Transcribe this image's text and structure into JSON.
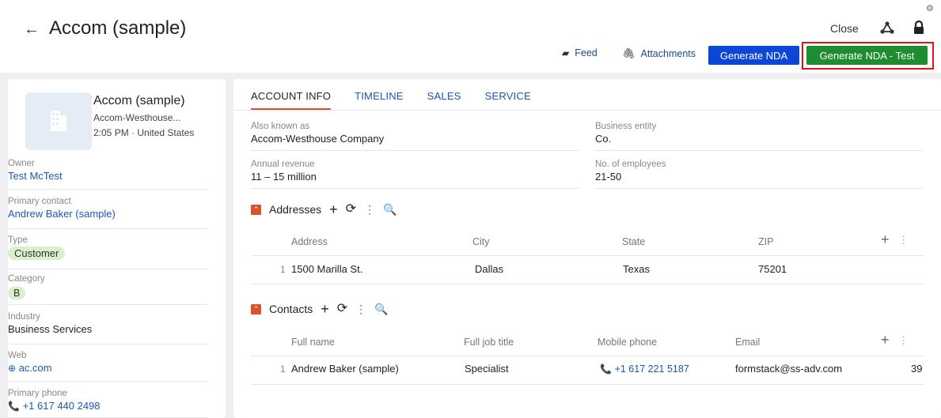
{
  "header": {
    "back_icon": "←",
    "title": "Accom (sample)",
    "close_label": "Close",
    "feed_label": "Feed",
    "attachments_label": "Attachments",
    "generate_nda_label": "Generate NDA",
    "generate_nda_test_label": "Generate NDA - Test",
    "highlight_color": "#e8101b"
  },
  "sidebar": {
    "name": "Accom (sample)",
    "subtitle": "Accom-Westhouse...",
    "time_location": "2:05 PM · United States",
    "fields": [
      {
        "label": "Owner",
        "value": "Test McTest"
      },
      {
        "label": "Primary contact",
        "value": "Andrew Baker (sample)"
      },
      {
        "label": "Type",
        "value": "Customer"
      },
      {
        "label": "Category",
        "value": "B"
      },
      {
        "label": "Industry",
        "value": "Business Services"
      },
      {
        "label": "Web",
        "value": "ac.com"
      },
      {
        "label": "Primary phone",
        "value": "+1 617 440 2498"
      }
    ]
  },
  "tabs": [
    "ACCOUNT INFO",
    "TIMELINE",
    "SALES",
    "SERVICE"
  ],
  "info": [
    {
      "label": "Also known as",
      "value": "Accom-Westhouse Company"
    },
    {
      "label": "Business entity",
      "value": "Co."
    },
    {
      "label": "Annual revenue",
      "value": "11 – 15 million"
    },
    {
      "label": "No. of employees",
      "value": "21-50"
    }
  ],
  "addresses": {
    "title": "Addresses",
    "columns": [
      "Address",
      "City",
      "State",
      "ZIP"
    ],
    "rows": [
      {
        "num": "1",
        "address": "1500 Marilla St.",
        "city": "Dallas",
        "state": "Texas",
        "zip": "75201"
      }
    ]
  },
  "contacts": {
    "title": "Contacts",
    "columns": [
      "Full name",
      "Full job title",
      "Mobile phone",
      "Email"
    ],
    "rows": [
      {
        "num": "1",
        "name": "Andrew Baker (sample)",
        "job": "Specialist",
        "phone": "+1 617 221 5187",
        "email": "formstack@ss-adv.com",
        "extra": "39"
      }
    ]
  }
}
